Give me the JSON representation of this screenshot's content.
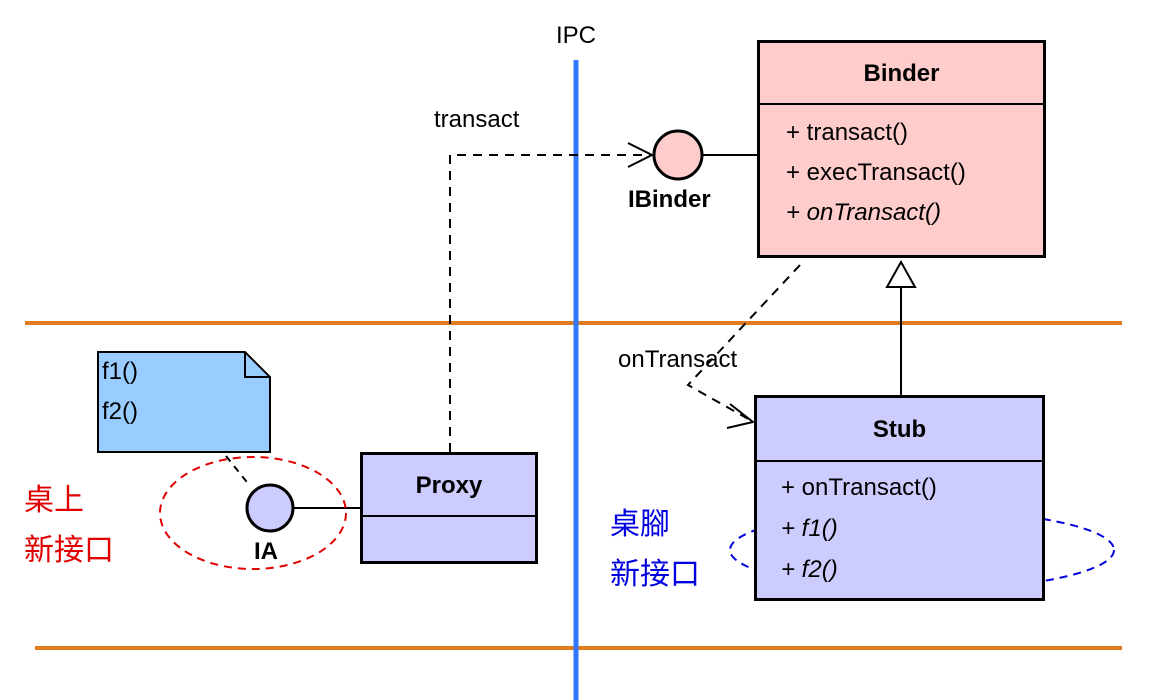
{
  "ipc_label": "IPC",
  "arrow_labels": {
    "transact": "transact",
    "on_transact": "onTransact"
  },
  "interfaces": {
    "ibinder": "IBinder",
    "ia": "IA"
  },
  "binder": {
    "name": "Binder",
    "operations": [
      "+ transact()",
      "+ execTransact()",
      "+ onTransact()"
    ]
  },
  "stub": {
    "name": "Stub",
    "operations": [
      "+ onTransact()",
      "+ f1()",
      "+ f2()"
    ]
  },
  "proxy": {
    "name": "Proxy"
  },
  "note": {
    "lines": [
      "f1()",
      "f2()"
    ]
  },
  "annotations": {
    "left": [
      "桌上",
      "新接口"
    ],
    "right": [
      "桌腳",
      "新接口"
    ]
  },
  "colors": {
    "ipc_line": "#3377ff",
    "layer_lines": "#e07b1f",
    "binder_fill": "#ffcccc",
    "stub_fill": "#ccccff",
    "proxy_fill": "#ccccff",
    "note_fill": "#99ccff",
    "left_annotation": "#e00000",
    "right_annotation": "#0000e0"
  }
}
